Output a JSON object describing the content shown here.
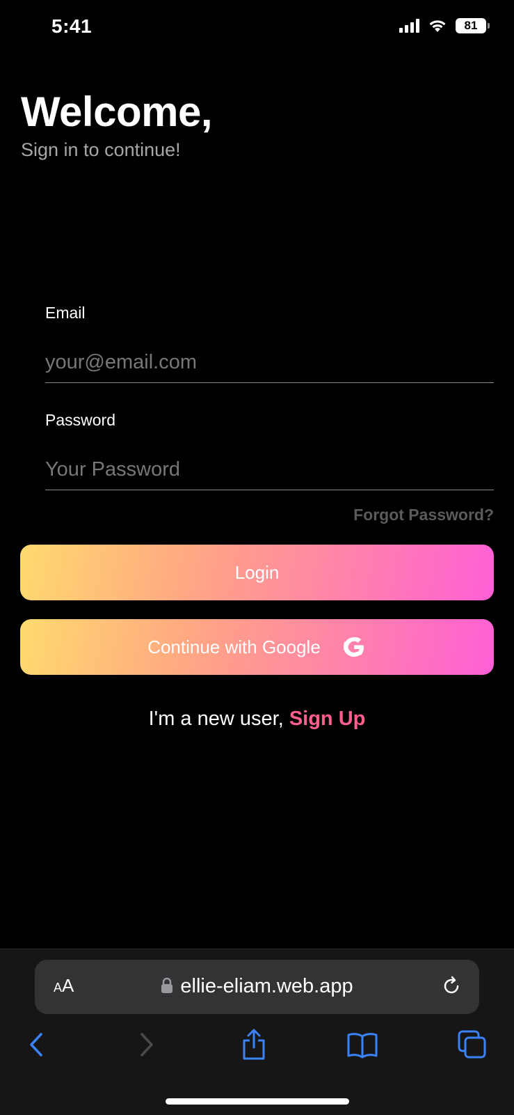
{
  "status_bar": {
    "time": "5:41",
    "battery": "81"
  },
  "header": {
    "title": "Welcome,",
    "subtitle": "Sign in to continue!"
  },
  "form": {
    "email_label": "Email",
    "email_placeholder": "your@email.com",
    "email_value": "",
    "password_label": "Password",
    "password_placeholder": "Your Password",
    "password_value": "",
    "forgot_label": "Forgot Password?"
  },
  "buttons": {
    "login_label": "Login",
    "google_label": "Continue with Google",
    "google_icon": "google-g-icon"
  },
  "signup": {
    "prompt": "I'm a new user, ",
    "link_label": "Sign Up"
  },
  "browser": {
    "aa_small": "A",
    "aa_large": "A",
    "url": "ellie-eliam.web.app",
    "icons": [
      "lock-icon",
      "reload-icon",
      "back-icon",
      "forward-icon",
      "share-icon",
      "bookmarks-icon",
      "tabs-icon"
    ]
  },
  "colors": {
    "accent_pink": "#ff5e8e",
    "gradient_start": "#ffda6e",
    "gradient_end": "#ff5fd6",
    "safari_blue": "#3b82f6"
  }
}
